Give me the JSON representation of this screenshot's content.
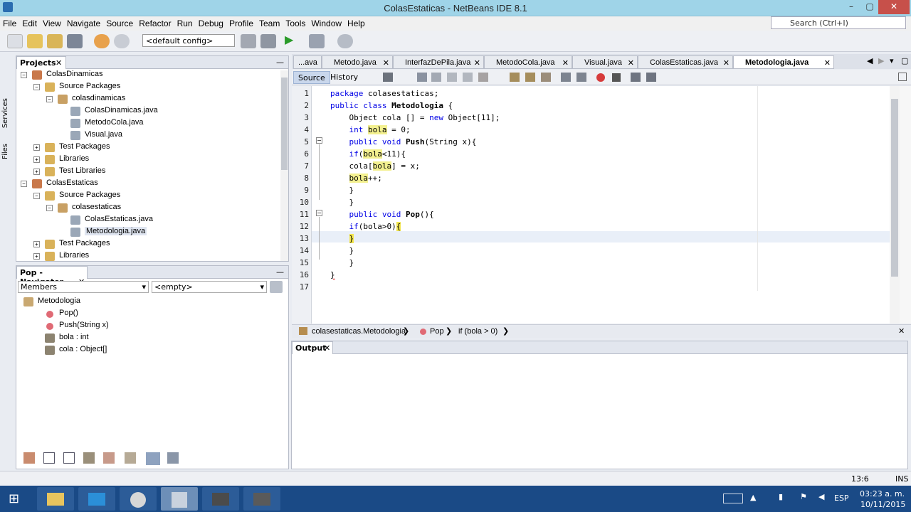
{
  "window": {
    "title": "ColasEstaticas - NetBeans IDE 8.1",
    "minimize": "–",
    "maximize": "▢",
    "close": "✕"
  },
  "menu": [
    "File",
    "Edit",
    "View",
    "Navigate",
    "Source",
    "Refactor",
    "Run",
    "Debug",
    "Profile",
    "Team",
    "Tools",
    "Window",
    "Help"
  ],
  "search": {
    "placeholder": "Search (Ctrl+I)"
  },
  "toolbar": {
    "config_value": "<default config>"
  },
  "sidebar": {
    "services": "Services",
    "files": "Files"
  },
  "projects": {
    "tab": "Projects",
    "items": [
      {
        "label": "ColasDinamicas",
        "depth": 0,
        "exp": "−",
        "icon": "project"
      },
      {
        "label": "Source Packages",
        "depth": 1,
        "exp": "−",
        "icon": "folder"
      },
      {
        "label": "colasdinamicas",
        "depth": 2,
        "exp": "−",
        "icon": "package"
      },
      {
        "label": "ColasDinamicas.java",
        "depth": 3,
        "exp": "",
        "icon": "java"
      },
      {
        "label": "MetodoCola.java",
        "depth": 3,
        "exp": "",
        "icon": "java"
      },
      {
        "label": "Visual.java",
        "depth": 3,
        "exp": "",
        "icon": "java"
      },
      {
        "label": "Test Packages",
        "depth": 1,
        "exp": "+",
        "icon": "folder"
      },
      {
        "label": "Libraries",
        "depth": 1,
        "exp": "+",
        "icon": "folder"
      },
      {
        "label": "Test Libraries",
        "depth": 1,
        "exp": "+",
        "icon": "folder"
      },
      {
        "label": "ColasEstaticas",
        "depth": 0,
        "exp": "−",
        "icon": "project"
      },
      {
        "label": "Source Packages",
        "depth": 1,
        "exp": "−",
        "icon": "folder"
      },
      {
        "label": "colasestaticas",
        "depth": 2,
        "exp": "−",
        "icon": "package"
      },
      {
        "label": "ColasEstaticas.java",
        "depth": 3,
        "exp": "",
        "icon": "java"
      },
      {
        "label": "Metodologia.java",
        "depth": 3,
        "exp": "",
        "icon": "java",
        "selected": true
      },
      {
        "label": "Test Packages",
        "depth": 1,
        "exp": "+",
        "icon": "folder"
      },
      {
        "label": "Libraries",
        "depth": 1,
        "exp": "+",
        "icon": "folder"
      }
    ]
  },
  "navigator": {
    "tab": "Pop - Navigator",
    "members_select": "Members",
    "filter_select": "<empty>",
    "items": [
      {
        "label": "Metodologia",
        "depth": 0,
        "icon": "class"
      },
      {
        "label": "Pop()",
        "depth": 1,
        "icon": "method"
      },
      {
        "label": "Push(String x)",
        "depth": 1,
        "icon": "method"
      },
      {
        "label": "bola : int",
        "depth": 1,
        "icon": "field"
      },
      {
        "label": "cola : Object[]",
        "depth": 1,
        "icon": "field"
      }
    ]
  },
  "editor": {
    "tabs": [
      "...ava",
      "Metodo.java",
      "InterfazDePila.java",
      "MetodoCola.java",
      "Visual.java",
      "ColasEstaticas.java",
      "Metodologia.java"
    ],
    "active_tab": "Metodologia.java",
    "source_label": "Source",
    "history_label": "History",
    "line_numbers": [
      "1",
      "2",
      "3",
      "4",
      "5",
      "6",
      "7",
      "8",
      "9",
      "10",
      "11",
      "12",
      "13",
      "14",
      "15",
      "16",
      "17"
    ]
  },
  "breadcrumb": {
    "class": "colasestaticas.Metodologia",
    "method": "Pop",
    "stmt": "if (bola > 0)"
  },
  "output": {
    "tab": "Output"
  },
  "status": {
    "position": "13:6",
    "mode": "INS"
  },
  "taskbar": {
    "lang": "ESP",
    "time": "03:23 a. m.",
    "date": "10/11/2015"
  }
}
